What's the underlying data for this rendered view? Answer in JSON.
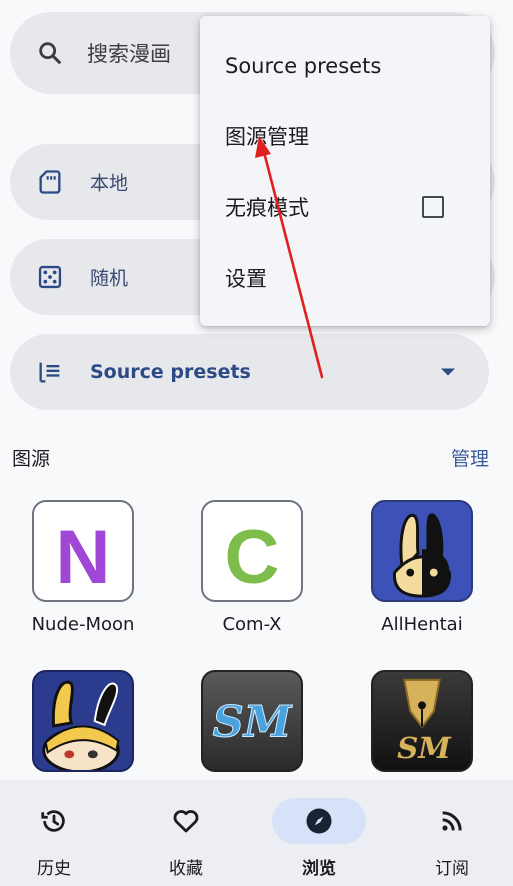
{
  "search": {
    "placeholder": "搜索漫画",
    "icon": "search-icon"
  },
  "quick": [
    {
      "label": "本地",
      "icon": "sd-card-icon"
    },
    {
      "label": "随机",
      "icon": "dice-icon"
    }
  ],
  "presets": {
    "label": "Source presets",
    "icon": "list-icon"
  },
  "section": {
    "title": "图源",
    "action": "管理"
  },
  "sources": [
    {
      "name": "Nude-Moon",
      "letter": "N",
      "color": "#a047d6"
    },
    {
      "name": "Com-X",
      "letter": "C",
      "color": "#7cbd4b"
    },
    {
      "name": "AllHentai",
      "letter": "",
      "color": "#3d52b8"
    },
    {
      "name": "",
      "letter": "",
      "color": "#2b3b8e"
    },
    {
      "name": "",
      "letter": "",
      "color": "#3a3a3a"
    },
    {
      "name": "",
      "letter": "",
      "color": "#1c1c1c"
    }
  ],
  "nav": [
    {
      "label": "历史",
      "icon": "history-icon"
    },
    {
      "label": "收藏",
      "icon": "heart-icon"
    },
    {
      "label": "浏览",
      "icon": "compass-icon",
      "active": true
    },
    {
      "label": "订阅",
      "icon": "rss-icon"
    }
  ],
  "menu": {
    "items": [
      {
        "label": "Source presets"
      },
      {
        "label": "图源管理"
      },
      {
        "label": "无痕模式",
        "checkbox": false
      },
      {
        "label": "设置"
      }
    ]
  },
  "colors": {
    "accent": "#2c4a86",
    "annotation": "#e02020"
  }
}
